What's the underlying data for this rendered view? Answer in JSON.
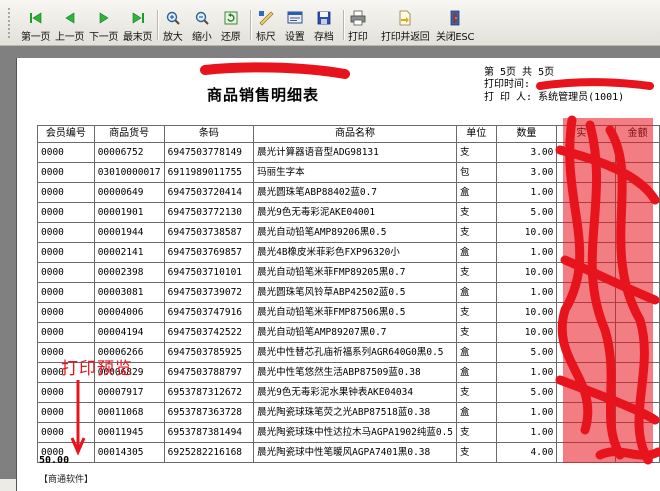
{
  "toolbar": {
    "buttons": [
      {
        "label": "第一页",
        "icon": "first-page-icon"
      },
      {
        "label": "上一页",
        "icon": "prev-page-icon"
      },
      {
        "label": "下一页",
        "icon": "next-page-icon"
      },
      {
        "label": "最末页",
        "icon": "last-page-icon"
      },
      {
        "label": "放大",
        "icon": "zoom-in-icon"
      },
      {
        "label": "缩小",
        "icon": "zoom-out-icon"
      },
      {
        "label": "还原",
        "icon": "restore-icon"
      },
      {
        "label": "标尺",
        "icon": "ruler-icon"
      },
      {
        "label": "设置",
        "icon": "settings-icon"
      },
      {
        "label": "存档",
        "icon": "save-icon"
      },
      {
        "label": "打印",
        "icon": "print-icon"
      },
      {
        "label": "打印并返回",
        "icon": "print-return-icon"
      },
      {
        "label": "关闭ESC",
        "icon": "close-icon"
      }
    ]
  },
  "report": {
    "title": "商品销售明细表",
    "page_info": "第 5页 共 5页",
    "print_time_label": "打印时间:",
    "printer_label": "打 印 人: 系统管理员(1001)",
    "total": "50.00",
    "footer": "【商通软件】"
  },
  "table": {
    "headers": [
      "会员编号",
      "商品货号",
      "条码",
      "商品名称",
      "单位",
      "数量",
      "实价",
      "金额"
    ],
    "rows": [
      {
        "member": "0000",
        "code": "00006752",
        "barcode": "6947503778149",
        "name": "晨光计算器语音型ADG98131",
        "unit": "支",
        "qty": "3.00"
      },
      {
        "member": "0000",
        "code": "03010000017",
        "barcode": "6911989011755",
        "name": "玛丽生字本",
        "unit": "包",
        "qty": "3.00"
      },
      {
        "member": "0000",
        "code": "00000649",
        "barcode": "6947503720414",
        "name": "晨光圆珠笔ABP88402蓝0.7",
        "unit": "盒",
        "qty": "1.00"
      },
      {
        "member": "0000",
        "code": "00001901",
        "barcode": "6947503772130",
        "name": "晨光9色无毒彩泥AKE04001",
        "unit": "支",
        "qty": "5.00"
      },
      {
        "member": "0000",
        "code": "00001944",
        "barcode": "6947503738587",
        "name": "晨光自动铅笔AMP89206黑0.5",
        "unit": "支",
        "qty": "10.00"
      },
      {
        "member": "0000",
        "code": "00002141",
        "barcode": "6947503769857",
        "name": "晨光4B橡皮米菲彩色FXP96320小",
        "unit": "盒",
        "qty": "1.00"
      },
      {
        "member": "0000",
        "code": "00002398",
        "barcode": "6947503710101",
        "name": "晨光自动铅笔米菲FMP89205黑0.7",
        "unit": "支",
        "qty": "10.00"
      },
      {
        "member": "0000",
        "code": "00003081",
        "barcode": "6947503739072",
        "name": "晨光圆珠笔风铃草ABP42502蓝0.5",
        "unit": "盒",
        "qty": "1.00"
      },
      {
        "member": "0000",
        "code": "00004006",
        "barcode": "6947503747916",
        "name": "晨光自动铅笔米菲FMP87506黑0.5",
        "unit": "支",
        "qty": "10.00"
      },
      {
        "member": "0000",
        "code": "00004194",
        "barcode": "6947503742522",
        "name": "晨光自动铅笔AMP89207黑0.7",
        "unit": "支",
        "qty": "10.00"
      },
      {
        "member": "0000",
        "code": "00006266",
        "barcode": "6947503785925",
        "name": "晨光中性替芯孔庙祈福系列AGR640G0黑0.5",
        "unit": "盒",
        "qty": "5.00"
      },
      {
        "member": "0000",
        "code": "00006829",
        "barcode": "6947503788797",
        "name": "晨光中性笔悠然生活ABP87509蓝0.38",
        "unit": "盒",
        "qty": "1.00"
      },
      {
        "member": "0000",
        "code": "00007917",
        "barcode": "6953787312672",
        "name": "晨光9色无毒彩泥水果钟表AKE04034",
        "unit": "支",
        "qty": "5.00"
      },
      {
        "member": "0000",
        "code": "00011068",
        "barcode": "6953787363728",
        "name": "晨光陶瓷球珠笔荧之光ABP87518蓝0.38",
        "unit": "盒",
        "qty": "1.00"
      },
      {
        "member": "0000",
        "code": "00011945",
        "barcode": "6953787381494",
        "name": "晨光陶瓷球珠中性达拉木马AGPA1902纯蓝0.5",
        "unit": "支",
        "qty": "1.00"
      },
      {
        "member": "0000",
        "code": "00014305",
        "barcode": "6925282216168",
        "name": "晨光陶瓷球中性笔暖风AGPA7401黑0.38",
        "unit": "支",
        "qty": "4.00"
      }
    ]
  },
  "annotation": {
    "text": "打印预览",
    "color": "#e8141d"
  }
}
